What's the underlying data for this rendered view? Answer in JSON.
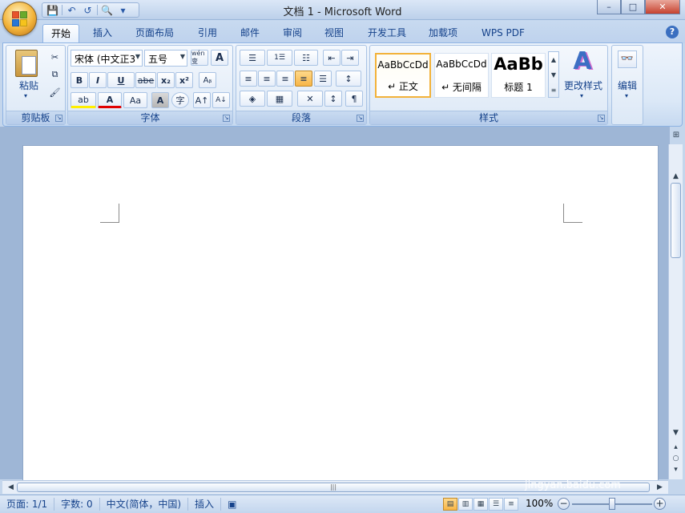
{
  "window": {
    "title": "文档 1 - Microsoft Word",
    "controls": {
      "minimize": "–",
      "maximize": "□",
      "close": "✕"
    }
  },
  "qat": {
    "save": "💾",
    "undo": "↶",
    "redo": "↺",
    "print_preview": "🔍",
    "customize": "▾"
  },
  "tabs": [
    {
      "label": "开始",
      "active": true
    },
    {
      "label": "插入"
    },
    {
      "label": "页面布局"
    },
    {
      "label": "引用"
    },
    {
      "label": "邮件"
    },
    {
      "label": "审阅"
    },
    {
      "label": "视图"
    },
    {
      "label": "开发工具"
    },
    {
      "label": "加载项"
    },
    {
      "label": "WPS PDF"
    }
  ],
  "help": "?",
  "groups": {
    "clipboard": {
      "label": "剪贴板",
      "paste": "粘贴",
      "cut": "✂",
      "copy": "⧉",
      "format_painter": "🖌"
    },
    "font": {
      "label": "字体",
      "font_name": "宋体 (中文正3",
      "font_size": "五号",
      "phonetic": "wén 变",
      "char_border": "A",
      "bold": "B",
      "italic": "I",
      "underline": "U",
      "strike": "abe",
      "subscript": "x₂",
      "superscript": "x²",
      "clear": "Aᵦ",
      "highlight": "ab",
      "font_color": "A",
      "change_case": "Aa",
      "char_shading": "A",
      "enclose": "字",
      "grow": "A↑",
      "shrink": "A↓"
    },
    "paragraph": {
      "label": "段落",
      "bullets": "☰",
      "numbering": "1☰",
      "multilevel": "☷",
      "decrease_indent": "⇤",
      "increase_indent": "⇥",
      "align_left": "≡",
      "center": "≡",
      "align_right": "≡",
      "justify": "≡",
      "distribute": "☰",
      "line_spacing": "↕",
      "shading": "◈",
      "borders": "▦",
      "chinese_layout": "✕",
      "sort": "↕",
      "show_marks": "¶"
    },
    "styles": {
      "label": "样式",
      "tiles": [
        {
          "sample": "AaBbCcDd",
          "name": "↵ 正文"
        },
        {
          "sample": "AaBbCcDd",
          "name": "↵ 无间隔"
        },
        {
          "sample": "AaBb",
          "name": "标题 1"
        }
      ],
      "change_styles": "更改样式",
      "change_styles_icon": "A"
    },
    "editing": {
      "label": "编辑",
      "icon": "👓"
    }
  },
  "status": {
    "page": "页面: 1/1",
    "words": "字数: 0",
    "language": "中文(简体，中国)",
    "mode": "插入",
    "zoom": "100%",
    "zoom_value": 100
  },
  "watermark": {
    "main": "Bai😊 经验",
    "sub": "jingyan.baidu.com"
  }
}
